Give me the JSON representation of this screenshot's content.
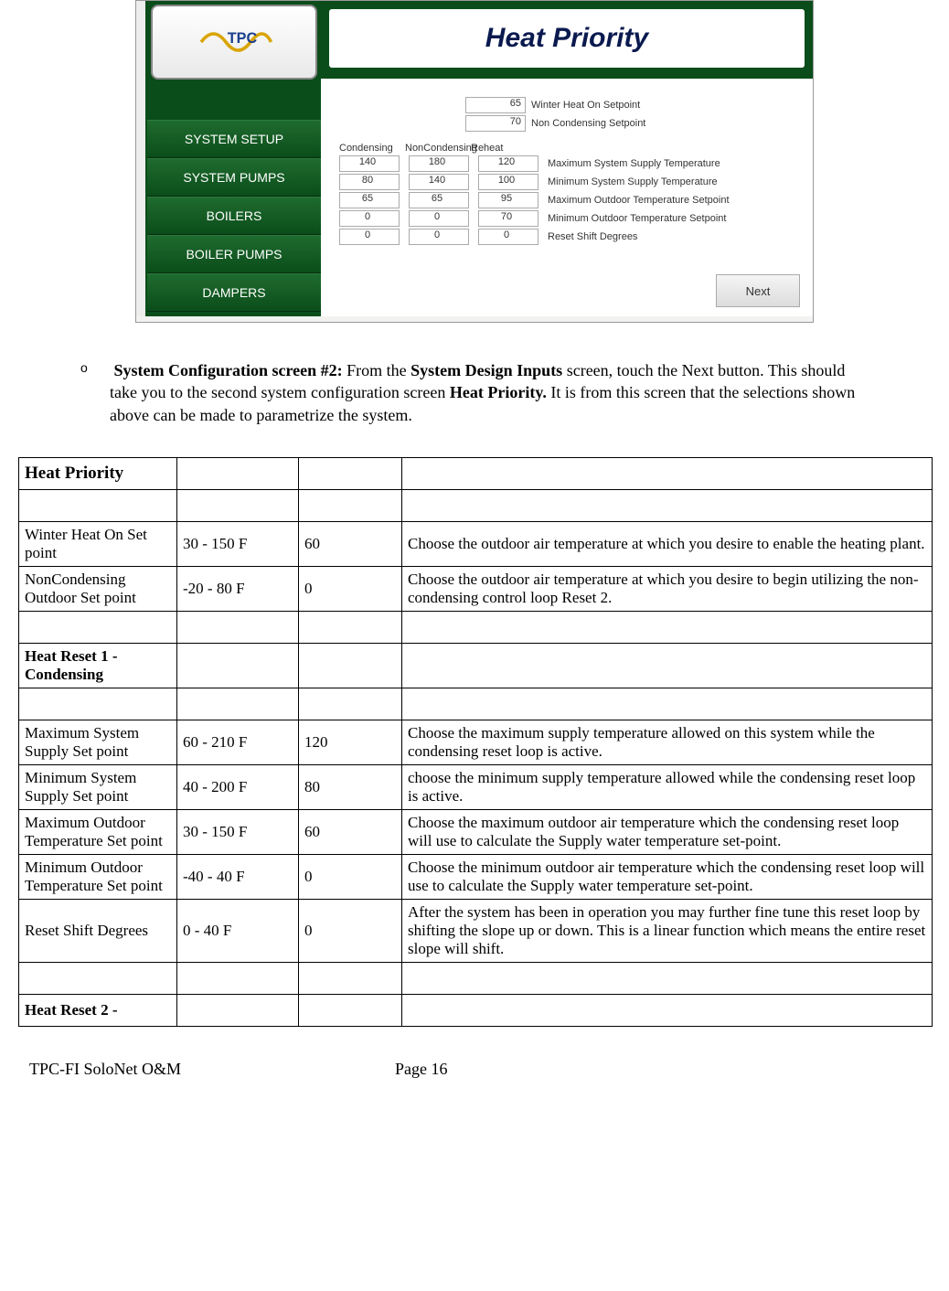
{
  "screenshot": {
    "title": "Heat Priority",
    "logo_text": "TPC",
    "sidebar": [
      "SYSTEM SETUP",
      "SYSTEM PUMPS",
      "BOILERS",
      "BOILER PUMPS",
      "DAMPERS"
    ],
    "top_fields": [
      {
        "value": "65",
        "label": "Winter Heat On Setpoint"
      },
      {
        "value": "70",
        "label": "Non Condensing Setpoint"
      }
    ],
    "column_headers": [
      "Condensing",
      "NonCondensing",
      "Reheat"
    ],
    "grid_rows": [
      {
        "vals": [
          "140",
          "180",
          "120"
        ],
        "label": "Maximum System Supply Temperature"
      },
      {
        "vals": [
          "80",
          "140",
          "100"
        ],
        "label": "Minimum System Supply Temperature"
      },
      {
        "vals": [
          "65",
          "65",
          "95"
        ],
        "label": "Maximum Outdoor Temperature Setpoint"
      },
      {
        "vals": [
          "0",
          "0",
          "70"
        ],
        "label": "Minimum Outdoor Temperature Setpoint"
      },
      {
        "vals": [
          "0",
          "0",
          "0"
        ],
        "label": "Reset Shift Degrees"
      }
    ],
    "next_button": "Next"
  },
  "instruction": {
    "bullet": "o",
    "bold1": "System Configuration screen #2:",
    "text1": "  From the ",
    "bold2": "System Design Inputs",
    "text2": " screen, touch the Next button.  This should take you to the second system configuration screen ",
    "bold3": "Heat Priority.",
    "text3": "  It is from this screen that the selections shown above can be made to parametrize the system."
  },
  "table": {
    "header": "Heat Priority",
    "rows": [
      {
        "c1": "Winter Heat On Set point",
        "c2": "30 - 150 F",
        "c3": "60",
        "c4": "Choose the outdoor air temperature at which you desire to enable the heating plant."
      },
      {
        "c1": "NonCondensing Outdoor Set point",
        "c2": "-20 - 80 F",
        "c3": "0",
        "c4": "Choose the outdoor air temperature at which you desire to begin utilizing the non-condensing control loop Reset 2."
      }
    ],
    "section1": "Heat Reset 1 - Condensing",
    "rows2": [
      {
        "c1": "Maximum System Supply Set point",
        "c2": "60 - 210 F",
        "c3": "120",
        "c4": "Choose the maximum supply temperature allowed on this system while the condensing reset loop is active."
      },
      {
        "c1": "Minimum System Supply Set point",
        "c2": "40 - 200 F",
        "c3": "80",
        "c4": "choose the minimum supply temperature allowed while the condensing reset loop is active."
      },
      {
        "c1": "Maximum Outdoor Temperature Set point",
        "c2": "30 - 150 F",
        "c3": "60",
        "c4": "Choose the maximum outdoor air temperature which the condensing reset loop will use to calculate the Supply water temperature set-point."
      },
      {
        "c1": "Minimum Outdoor Temperature Set point",
        "c2": "-40 - 40 F",
        "c3": "0",
        "c4": "Choose the minimum outdoor air temperature which the condensing reset loop will use to calculate the Supply water temperature set-point."
      },
      {
        "c1": "Reset Shift Degrees",
        "c2": "0 - 40 F",
        "c3": "0",
        "c4": "After the system has been in operation you may further fine tune this reset loop by shifting the slope up or down.  This is a linear function which means the entire reset slope will shift."
      }
    ],
    "section2": "Heat Reset 2 -"
  },
  "footer": {
    "left": "TPC-FI SoloNet O&M",
    "center": "Page 16"
  }
}
